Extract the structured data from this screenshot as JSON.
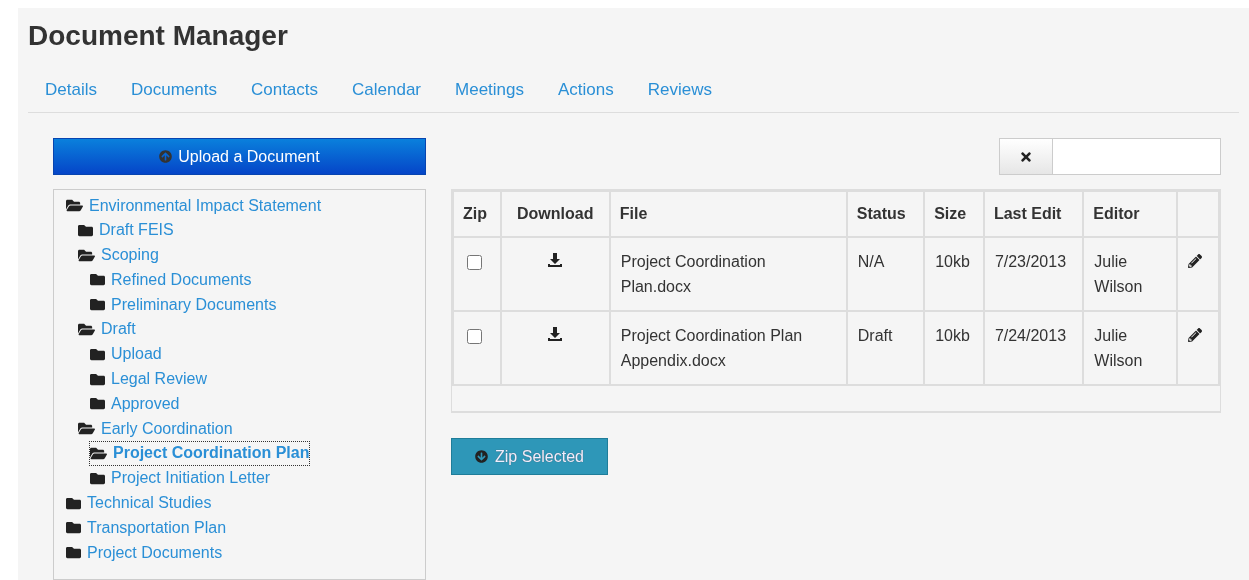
{
  "title": "Document Manager",
  "tabs": [
    {
      "label": "Details",
      "selected": false
    },
    {
      "label": "Documents",
      "selected": false
    },
    {
      "label": "Contacts",
      "selected": false
    },
    {
      "label": "Calendar",
      "selected": false
    },
    {
      "label": "Meetings",
      "selected": false
    },
    {
      "label": "Actions",
      "selected": false
    },
    {
      "label": "Reviews",
      "selected": false
    }
  ],
  "upload_button": "Upload a Document",
  "tree": [
    {
      "label": "Environmental Impact Statement",
      "expanded": true,
      "selected": false,
      "children": [
        {
          "label": "Draft FEIS",
          "expanded": false,
          "selected": false
        },
        {
          "label": "Scoping",
          "expanded": true,
          "selected": false,
          "children": [
            {
              "label": "Refined Documents",
              "expanded": false,
              "selected": false
            },
            {
              "label": "Preliminary Documents",
              "expanded": false,
              "selected": false
            }
          ]
        },
        {
          "label": "Draft",
          "expanded": true,
          "selected": false,
          "children": [
            {
              "label": "Upload",
              "expanded": false,
              "selected": false
            },
            {
              "label": "Legal Review",
              "expanded": false,
              "selected": false
            },
            {
              "label": "Approved",
              "expanded": false,
              "selected": false
            }
          ]
        },
        {
          "label": "Early Coordination",
          "expanded": true,
          "selected": false,
          "children": [
            {
              "label": "Project Coordination Plan",
              "expanded": true,
              "selected": true
            },
            {
              "label": "Project Initiation Letter",
              "expanded": false,
              "selected": false
            }
          ]
        }
      ]
    },
    {
      "label": "Technical Studies",
      "expanded": false,
      "selected": false
    },
    {
      "label": "Transportation Plan",
      "expanded": false,
      "selected": false
    },
    {
      "label": "Project Documents",
      "expanded": false,
      "selected": false
    }
  ],
  "columns": [
    "Zip",
    "Download",
    "File",
    "Status",
    "Size",
    "Last Edit",
    "Editor"
  ],
  "rows": [
    {
      "checked": false,
      "file": "Project Coordination Plan.docx",
      "status": "N/A",
      "size": "10kb",
      "last_edit": "7/23/2013",
      "editor": "Julie Wilson"
    },
    {
      "checked": false,
      "file": "Project Coordination Plan Appendix.docx",
      "status": "Draft",
      "size": "10kb",
      "last_edit": "7/24/2013",
      "editor": "Julie Wilson"
    }
  ],
  "zip_button": "Zip Selected"
}
